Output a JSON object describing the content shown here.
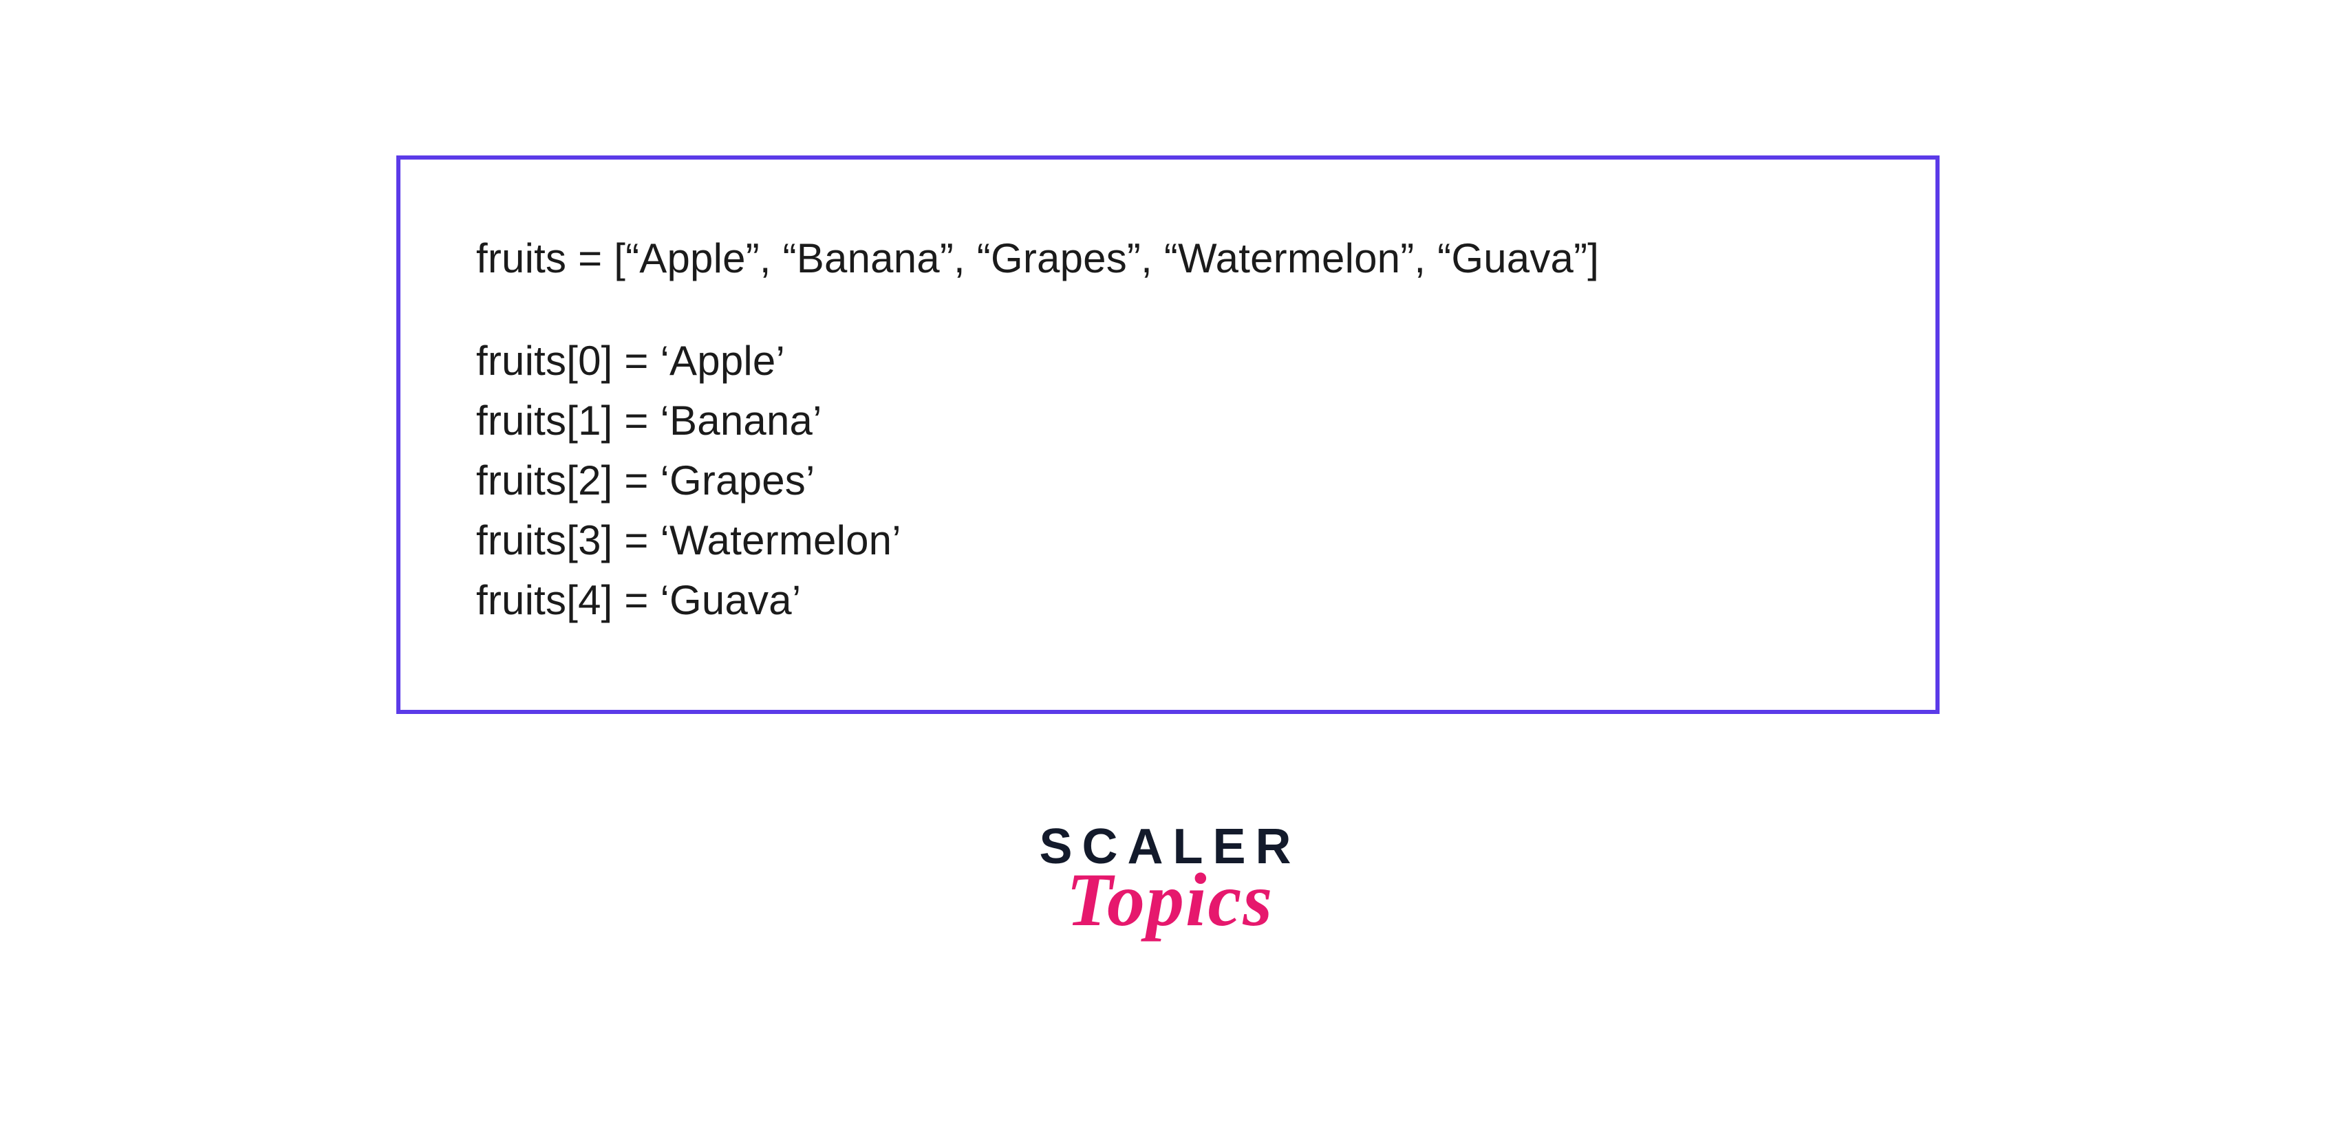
{
  "code": {
    "declaration": "fruits = [“Apple”, “Banana”, “Grapes”, “Watermelon”, “Guava”]",
    "lines": [
      "fruits[0] = ‘Apple’",
      "fruits[1] = ‘Banana’",
      "fruits[2] = ‘Grapes’",
      "fruits[3] = ‘Watermelon’",
      "fruits[4] = ‘Guava’"
    ]
  },
  "logo": {
    "top": "SCALER",
    "bottom": "Topics"
  },
  "colors": {
    "border": "#5b3be8",
    "text": "#1b1b1b",
    "logo_dark": "#131a2b",
    "logo_pink": "#e6186d"
  }
}
